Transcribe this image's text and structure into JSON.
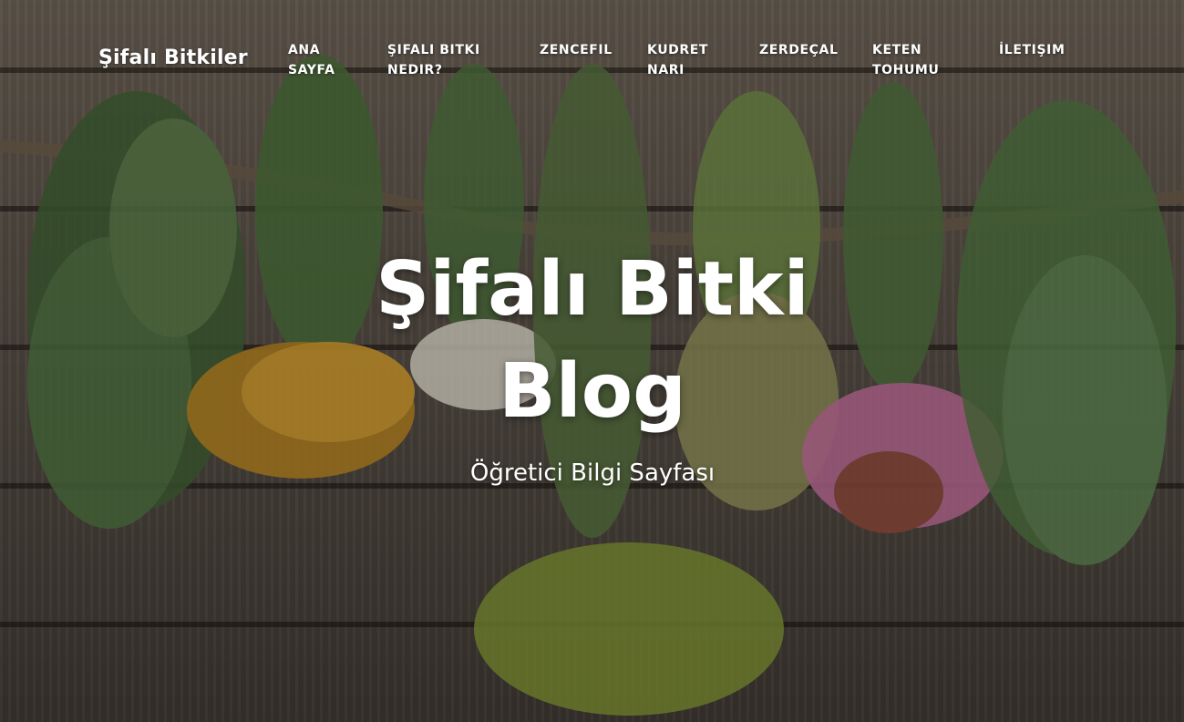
{
  "header": {
    "brand": "Şifalı Bitkiler",
    "nav": [
      {
        "label": "ANA SAYFA"
      },
      {
        "label": "ŞIFALI BITKI NEDIR?"
      },
      {
        "label": "ZENCEFIL"
      },
      {
        "label": "KUDRET NARI"
      },
      {
        "label": "ZERDEÇAL"
      },
      {
        "label": "KETEN TOHUMU"
      },
      {
        "label": "İLETIŞIM"
      }
    ]
  },
  "hero": {
    "title": "Şifalı Bitki Blog",
    "subtitle": "Öğretici Bilgi Sayfası",
    "background": "dried herb bundles hanging on a wooden wall"
  },
  "colors": {
    "text": "#ffffff",
    "wood": "#5b5249",
    "foliage": "#4e6b3c",
    "yellow_flowers": "#c9952a",
    "pink_flowers": "#c06a93"
  }
}
